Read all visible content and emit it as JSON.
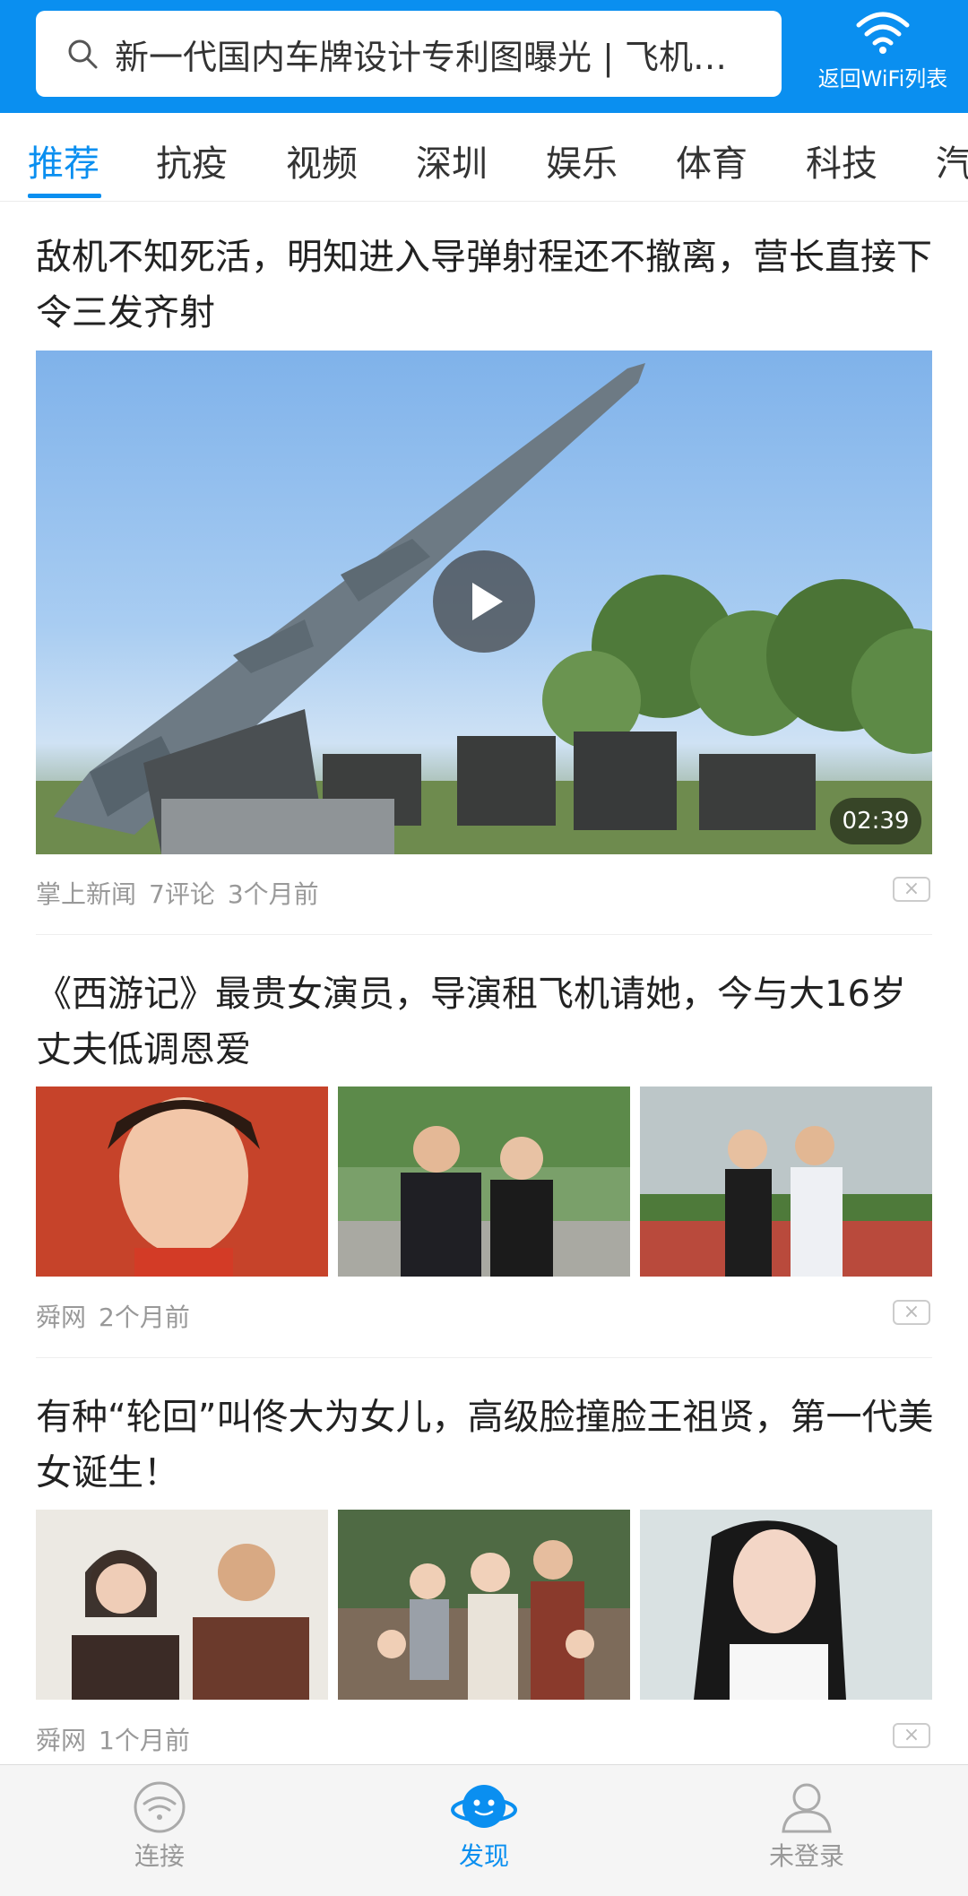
{
  "header": {
    "search_text": "新一代国内车牌设计专利图曝光 | 飞机…",
    "wifi_back_label": "返回WiFi列表",
    "icons": {
      "search": "search-icon",
      "wifi": "wifi-icon"
    }
  },
  "tabs": [
    {
      "label": "推荐",
      "active": true
    },
    {
      "label": "抗疫"
    },
    {
      "label": "视频"
    },
    {
      "label": "深圳"
    },
    {
      "label": "娱乐"
    },
    {
      "label": "体育"
    },
    {
      "label": "科技"
    },
    {
      "label": "汽"
    }
  ],
  "articles": [
    {
      "title": "敌机不知死活，明知进入导弹射程还不撤离，营长直接下令三发齐射",
      "type": "video",
      "duration": "02:39",
      "source": "掌上新闻",
      "comments": "7评论",
      "time": "3个月前"
    },
    {
      "title": "《西游记》最贵女演员，导演租飞机请她，今与大16岁丈夫低调恩爱",
      "type": "three-images",
      "source": "舜网",
      "time": "2个月前"
    },
    {
      "title": "有种“轮回”叫佟大为女儿，高级脸撞脸王祖贤，第一代美女诞生！",
      "type": "three-images",
      "source": "舜网",
      "time": "1个月前"
    }
  ],
  "close_glyph": "×",
  "bottom_nav": [
    {
      "label": "连接",
      "icon": "wifi-icon"
    },
    {
      "label": "发现",
      "icon": "planet-icon",
      "active": true
    },
    {
      "label": "未登录",
      "icon": "user-icon"
    }
  ],
  "colors": {
    "brand": "#0a8ff0",
    "meta": "#999999"
  }
}
